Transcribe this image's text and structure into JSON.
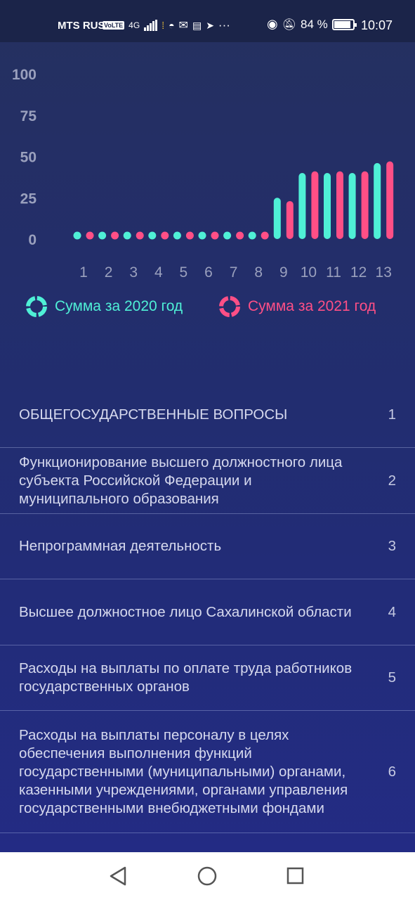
{
  "status_bar": {
    "carrier": "MTS RUS",
    "volte": "VoLTE",
    "network": "4G",
    "battery_percent": "84 %",
    "time": "10:07",
    "more": "···"
  },
  "chart_data": {
    "type": "bar",
    "categories": [
      "1",
      "2",
      "3",
      "4",
      "5",
      "6",
      "7",
      "8",
      "9",
      "10",
      "11",
      "12",
      "13"
    ],
    "series": [
      {
        "name": "Сумма за 2020 год",
        "color": "#4ff0d6",
        "values": [
          0,
          0,
          0,
          0,
          0,
          0,
          0,
          0,
          25,
          40,
          40,
          40,
          46
        ]
      },
      {
        "name": "Сумма за 2021 год",
        "color": "#ff4f86",
        "values": [
          0,
          0,
          0,
          0,
          0,
          0,
          0,
          0,
          23,
          41,
          41,
          41,
          47
        ]
      }
    ],
    "yticks": [
      "0",
      "25",
      "50",
      "75",
      "100"
    ],
    "ylim": [
      0,
      100
    ],
    "legend_position": "bottom"
  },
  "legend": {
    "item_2020": "Сумма за 2020 год",
    "item_2021": "Сумма за 2021 год"
  },
  "rows": [
    {
      "text": "ОБЩЕГОСУДАРСТВЕННЫЕ ВОПРОСЫ",
      "num": "1"
    },
    {
      "text": "Функционирование высшего должностного лица субъекта Российской Федерации и муниципального образования",
      "num": "2"
    },
    {
      "text": "Непрограммная деятельность",
      "num": "3"
    },
    {
      "text": "Высшее должностное лицо Сахалинской области",
      "num": "4"
    },
    {
      "text": "Расходы на выплаты по оплате труда работников государственных органов",
      "num": "5"
    },
    {
      "text": "Расходы на выплаты персоналу в целях обеспечения выполнения функций государственными (муниципальными) органами, казенными учреждениями, органами управления государственными внебюджетными фондами",
      "num": "6"
    }
  ],
  "nav": {
    "back_icon": "back-triangle-icon",
    "home_icon": "home-circle-icon",
    "recents_icon": "recents-square-icon"
  }
}
